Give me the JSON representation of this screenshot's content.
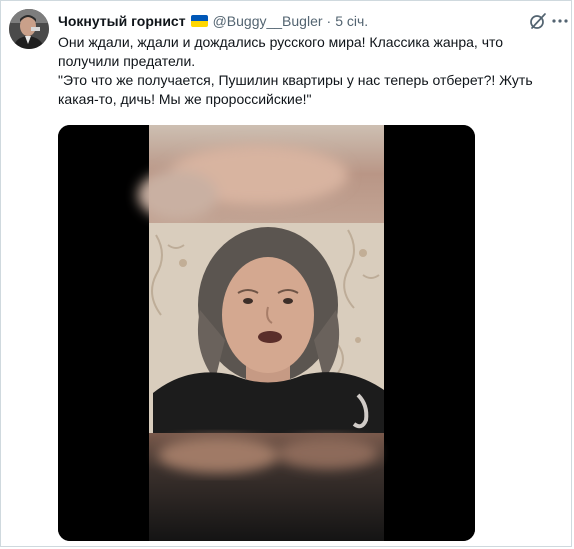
{
  "tweet": {
    "author_name": "Чокнутый горнист",
    "author_handle": "@Buggy__Bugler",
    "separator": "·",
    "time": "5 січ.",
    "text_line1": "Они ждали, ждали и дождались русского мира! Классика жанра, что получили предатели.",
    "text_line2": "\"Это что же получается, Пушилин квартиры у нас теперь отберет?! Жуть какая-то, дичь! Мы же пророссийские!\""
  },
  "icons": {
    "avatar": "avatar-portrait",
    "flag": "ukraine-flag-icon",
    "grok": "grok-icon",
    "more": "more-options-icon"
  },
  "colors": {
    "text_primary": "#0f1419",
    "text_secondary": "#536471",
    "flag_blue": "#0057b7",
    "flag_yellow": "#ffd700",
    "media_background": "#000000"
  }
}
